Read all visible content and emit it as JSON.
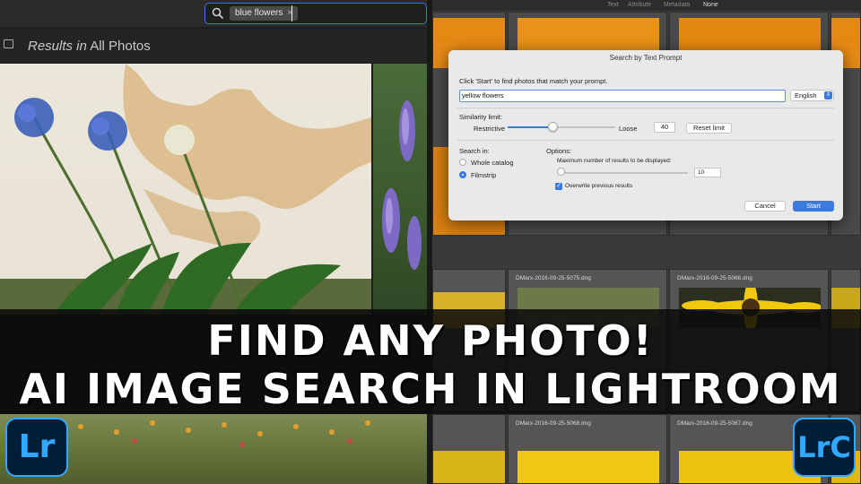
{
  "search": {
    "chip_label": "blue flowers",
    "chip_remove": "×"
  },
  "results": {
    "prefix": "Results in",
    "scope": "All Photos"
  },
  "filter_bar": {
    "items": [
      "Text",
      "Attribute",
      "Metadata",
      "None"
    ]
  },
  "dialog": {
    "title": "Search by Text Prompt",
    "instructions": "Click 'Start' to find photos that match your prompt.",
    "prompt_value": "yellow flowers",
    "language": "English",
    "similarity_label": "Similarity limit:",
    "restrictive_label": "Restrictive",
    "loose_label": "Loose",
    "limit_value": "40",
    "similarity_fraction": 0.42,
    "reset_label": "Reset limit",
    "search_in_label": "Search in:",
    "scope_options": [
      {
        "label": "Whole catalog",
        "selected": false
      },
      {
        "label": "Filmstrip",
        "selected": true
      }
    ],
    "options_label": "Options:",
    "max_results_label": "Maximum number of results to be displayed:",
    "max_results_value": "10",
    "max_results_fraction": 0.0,
    "overwrite_label": "Overwrite previous results",
    "overwrite_checked": true,
    "cancel_label": "Cancel",
    "start_label": "Start"
  },
  "filmstrip": {
    "filenames": [
      "DMarx-2016-09-25-5075.dng",
      "DMarx-2016-09-25-5066.dng",
      "DMarx-2016-09-25-5068.dng",
      "DMarx-2016-09-25-5067.dng"
    ]
  },
  "banner": {
    "line1": "FIND ANY PHOTO!",
    "line2": "AI IMAGE SEARCH IN LIGHTROOM"
  },
  "logos": {
    "left": "Lr",
    "right": "LrC",
    "color": "#31a8ff",
    "background": "#001e36"
  },
  "colors": {
    "accent": "#3b7be0"
  }
}
